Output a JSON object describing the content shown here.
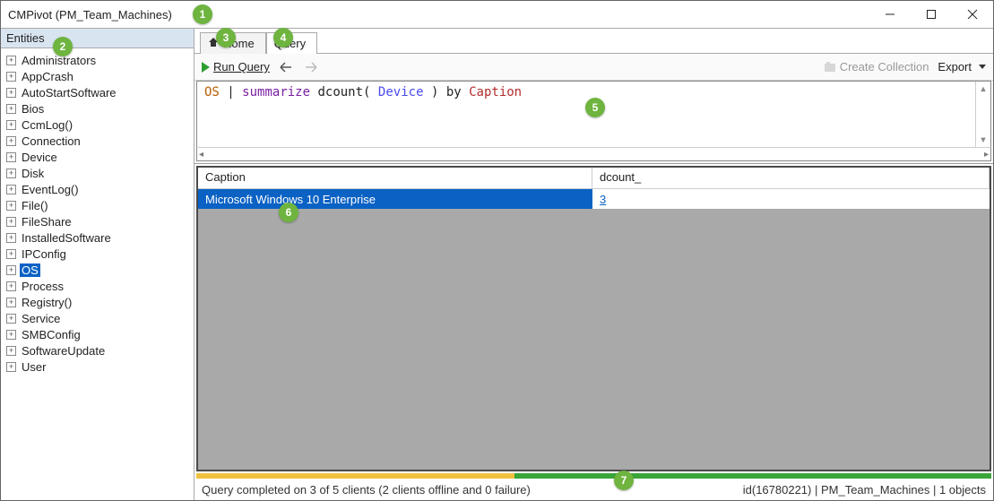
{
  "window": {
    "title": "CMPivot (PM_Team_Machines)"
  },
  "sidebar": {
    "header": "Entities",
    "items": [
      {
        "label": "Administrators"
      },
      {
        "label": "AppCrash"
      },
      {
        "label": "AutoStartSoftware"
      },
      {
        "label": "Bios"
      },
      {
        "label": "CcmLog()"
      },
      {
        "label": "Connection"
      },
      {
        "label": "Device"
      },
      {
        "label": "Disk"
      },
      {
        "label": "EventLog()"
      },
      {
        "label": "File()"
      },
      {
        "label": "FileShare"
      },
      {
        "label": "InstalledSoftware"
      },
      {
        "label": "IPConfig"
      },
      {
        "label": "OS",
        "selected": true
      },
      {
        "label": "Process"
      },
      {
        "label": "Registry()"
      },
      {
        "label": "Service"
      },
      {
        "label": "SMBConfig"
      },
      {
        "label": "SoftwareUpdate"
      },
      {
        "label": "User"
      }
    ]
  },
  "tabs": {
    "home": "Home",
    "query": "Query"
  },
  "toolbar": {
    "run_query": "Run Query",
    "create_collection": "Create Collection",
    "export": "Export"
  },
  "query": {
    "entity": "OS",
    "pipe": "|",
    "verb": "summarize",
    "func_open": "dcount(",
    "arg": "Device",
    "func_close": ")",
    "by": "by",
    "col": "Caption"
  },
  "results": {
    "columns": [
      "Caption",
      "dcount_"
    ],
    "rows": [
      {
        "caption": "Microsoft Windows 10 Enterprise",
        "dcount": "3"
      }
    ]
  },
  "progress": {
    "yellow_pct": 40,
    "green_pct": 60
  },
  "status": {
    "left": "Query completed on 3 of 5 clients (2 clients offline and 0 failure)",
    "right": "id(16780221)  |  PM_Team_Machines  |  1 objects"
  },
  "callouts": {
    "1": "1",
    "2": "2",
    "3": "3",
    "4": "4",
    "5": "5",
    "6": "6",
    "7": "7"
  }
}
